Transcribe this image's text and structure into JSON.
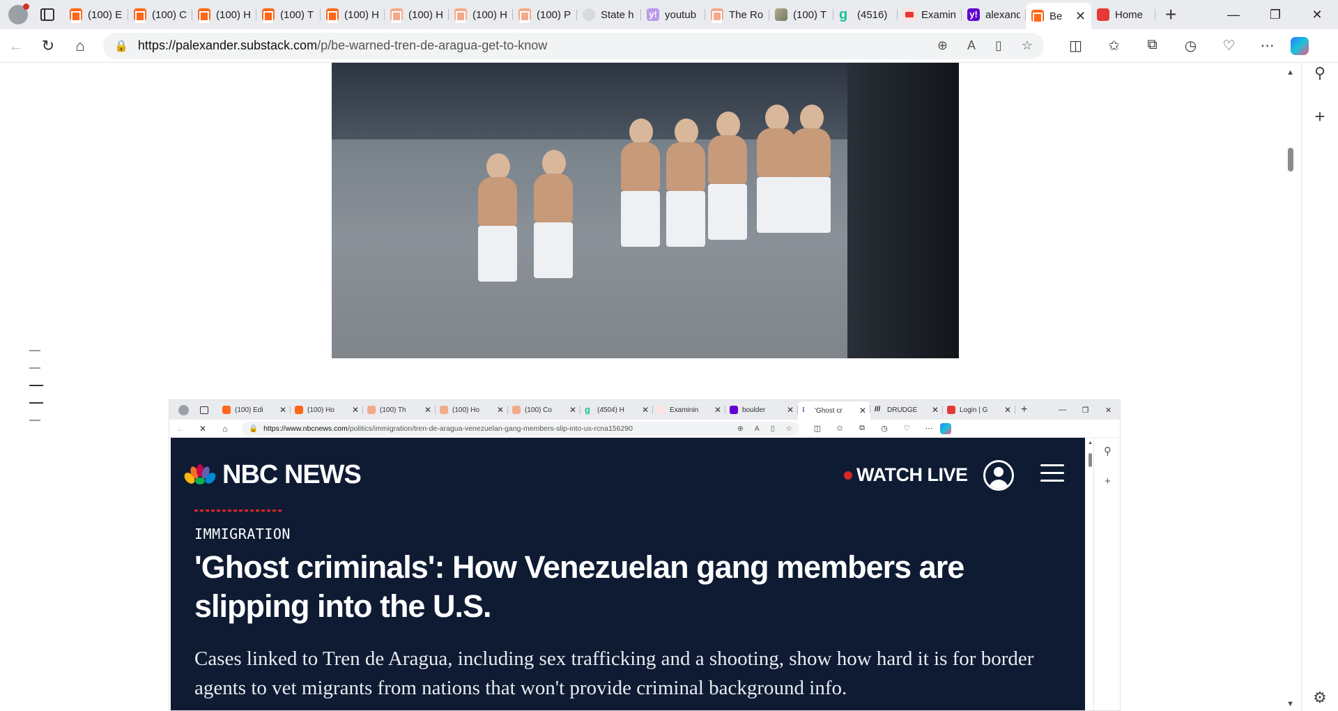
{
  "browser": {
    "tabs": [
      {
        "icon": "substack",
        "title": "(100) E"
      },
      {
        "icon": "substack",
        "title": "(100) C"
      },
      {
        "icon": "substack",
        "title": "(100) H"
      },
      {
        "icon": "substack",
        "title": "(100) T"
      },
      {
        "icon": "substack",
        "title": "(100) H"
      },
      {
        "icon": "substack-faded",
        "title": "(100) H"
      },
      {
        "icon": "substack-faded",
        "title": "(100) H"
      },
      {
        "icon": "substack-faded",
        "title": "(100) P"
      },
      {
        "icon": "grey-circle",
        "title": "State h"
      },
      {
        "icon": "yahoo-faded",
        "title": "youtub"
      },
      {
        "icon": "substack-faded",
        "title": "The Ro"
      },
      {
        "icon": "image",
        "title": "(100) T"
      },
      {
        "icon": "grammarly",
        "title": "(4516)"
      },
      {
        "icon": "youtube",
        "title": "Examin"
      },
      {
        "icon": "yahoo",
        "title": "alexand"
      },
      {
        "icon": "substack",
        "title": "Be",
        "active": true
      },
      {
        "icon": "red",
        "title": "Home"
      }
    ],
    "close_tab": "✕",
    "new_tab": "+",
    "url_host": "https://palexander.substack.com",
    "url_path": "/p/be-warned-tren-de-aragua-get-to-know"
  },
  "embedded": {
    "tabs": [
      {
        "icon": "substack",
        "title": "(100) Edi"
      },
      {
        "icon": "substack",
        "title": "(100) Ho"
      },
      {
        "icon": "substack-faded",
        "title": "(100) Th"
      },
      {
        "icon": "substack-faded",
        "title": "(100) Ho"
      },
      {
        "icon": "substack-faded",
        "title": "(100) Co"
      },
      {
        "icon": "grammarly",
        "title": "(4504) H"
      },
      {
        "icon": "youtube",
        "title": "Examinin"
      },
      {
        "icon": "yahoo",
        "title": "boulder"
      },
      {
        "icon": "ghost",
        "title": "'Ghost cr",
        "active": true
      },
      {
        "icon": "drudge",
        "title": "DRUDGE"
      },
      {
        "icon": "red",
        "title": "Login | G"
      }
    ],
    "url_host": "https://www.nbcnews.com",
    "url_path": "/politics/immigration/tren-de-aragua-venezuelan-gang-members-slip-into-us-rcna156290",
    "site": {
      "logo": "NBC NEWS",
      "watch_live": "WATCH LIVE",
      "section": "IMMIGRATION",
      "headline": "'Ghost criminals': How Venezuelan gang members are slipping into the U.S.",
      "dek": "Cases linked to Tren de Aragua, including sex trafficking and a shooting, show how hard it is for border agents to vet migrants from nations that won't provide criminal background info."
    }
  },
  "colors": {
    "nbc_bg": "#0e1b33",
    "live_red": "#d62828",
    "substack_orange": "#ff6719"
  }
}
